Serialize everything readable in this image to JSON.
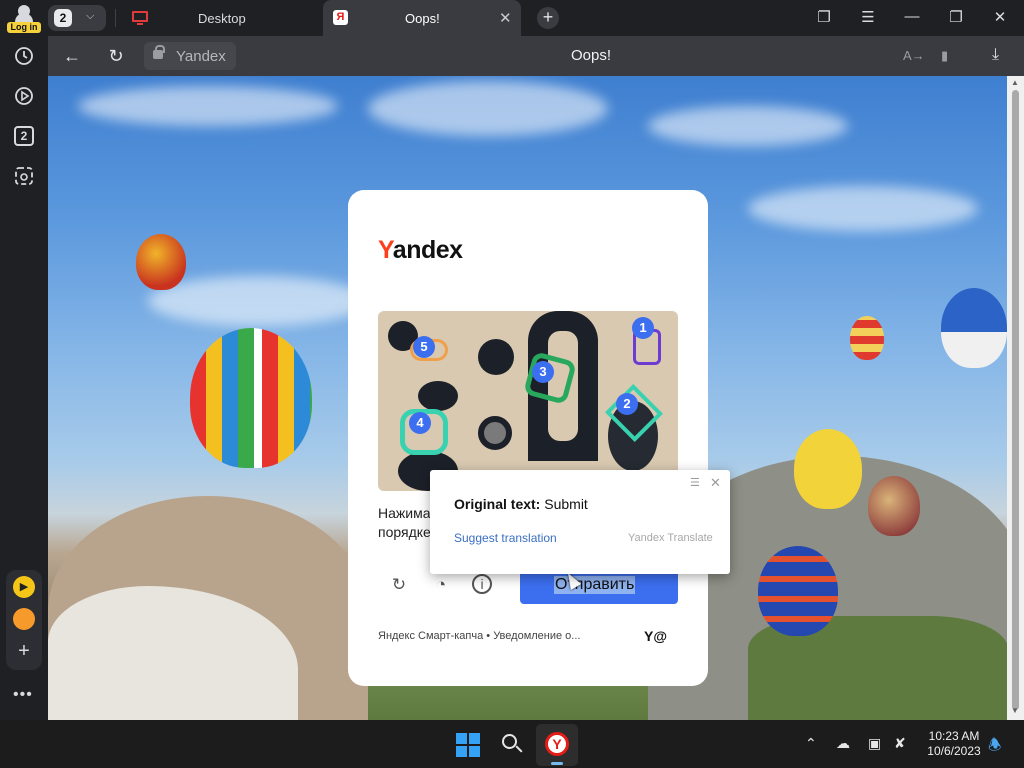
{
  "top_bar": {
    "login_label": "Log in",
    "tab_count": "2",
    "tabs": [
      {
        "title": "Desktop",
        "icon": "desktop-icon"
      },
      {
        "title": "Oops!",
        "icon": "yandex-favicon",
        "active": true
      }
    ]
  },
  "address_bar": {
    "site_label": "Yandex",
    "page_title": "Oops!"
  },
  "sidebar": {
    "badge": "2"
  },
  "captcha": {
    "logo_first": "Y",
    "logo_rest": "andex",
    "markers": [
      "1",
      "2",
      "3",
      "4",
      "5"
    ],
    "instruction_line1": "Нажима",
    "instruction_line2": "порядке",
    "submit_label": "Отправить",
    "submit_label_visible_tail": "править",
    "footer": "Яндекс Смарт-капча • Уведомление о...",
    "brand_mark": "Y@"
  },
  "translate_popup": {
    "original_label": "Original text:",
    "original_value": "Submit",
    "suggest_link": "Suggest translation",
    "brand": "Yandex Translate"
  },
  "taskbar": {
    "time": "10:23 AM",
    "date": "10/6/2023"
  },
  "colors": {
    "accent": "#3c6ff0",
    "yandex_red": "#fc3f1d",
    "popup_link": "#3b6fc2",
    "taskbar": "#1c1c1c"
  }
}
